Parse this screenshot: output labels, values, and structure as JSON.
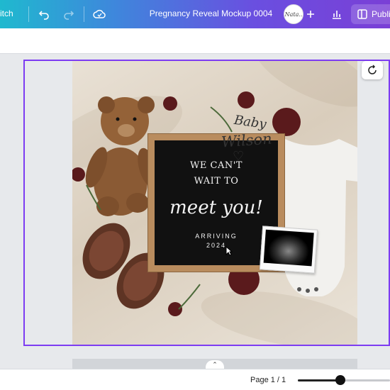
{
  "header": {
    "switch_label": "itch",
    "doc_title": "Pregnancy Reveal Mockup 0004",
    "avatar_text": "Nata..",
    "publish_label": "Publi",
    "icons": [
      "undo-icon",
      "redo-icon",
      "cloud-sync-icon",
      "plus-icon",
      "analytics-icon",
      "present-icon"
    ]
  },
  "canvas": {
    "board_line1": "WE CAN'T",
    "board_line2": "WAIT TO",
    "board_line3": "meet you!",
    "board_line4": "ARRIVING",
    "board_line5": "2024",
    "onesie_line1": "Baby",
    "onesie_line2": "Wilson",
    "onesie_heart": "♡"
  },
  "footer": {
    "page_indicator": "Page 1 / 1",
    "zoom_fraction": 0.46
  },
  "colors": {
    "selection": "#7d3cf2",
    "gradient_start": "#1fb9cf",
    "gradient_end": "#7a3fd6"
  }
}
